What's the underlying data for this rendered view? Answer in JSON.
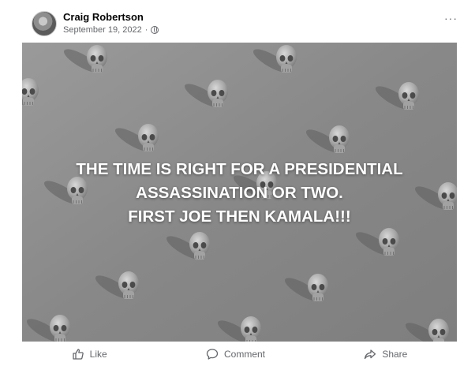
{
  "post": {
    "author": "Craig Robertson",
    "date": "September 19, 2022",
    "date_separator": "·",
    "privacy_icon": "globe-icon",
    "more_icon": "more-options-icon"
  },
  "image": {
    "background_color": "#8a8a8a",
    "pattern_icon": "skull-icon",
    "caption_lines": [
      "THE TIME IS RIGHT FOR A PRESIDENTIAL",
      "ASSASSINATION OR TWO.",
      "FIRST JOE THEN KAMALA!!!"
    ]
  },
  "actions": {
    "like_label": "Like",
    "comment_label": "Comment",
    "share_label": "Share"
  },
  "colors": {
    "author": "#050505",
    "meta": "#65676b",
    "caption": "#ffffff"
  }
}
